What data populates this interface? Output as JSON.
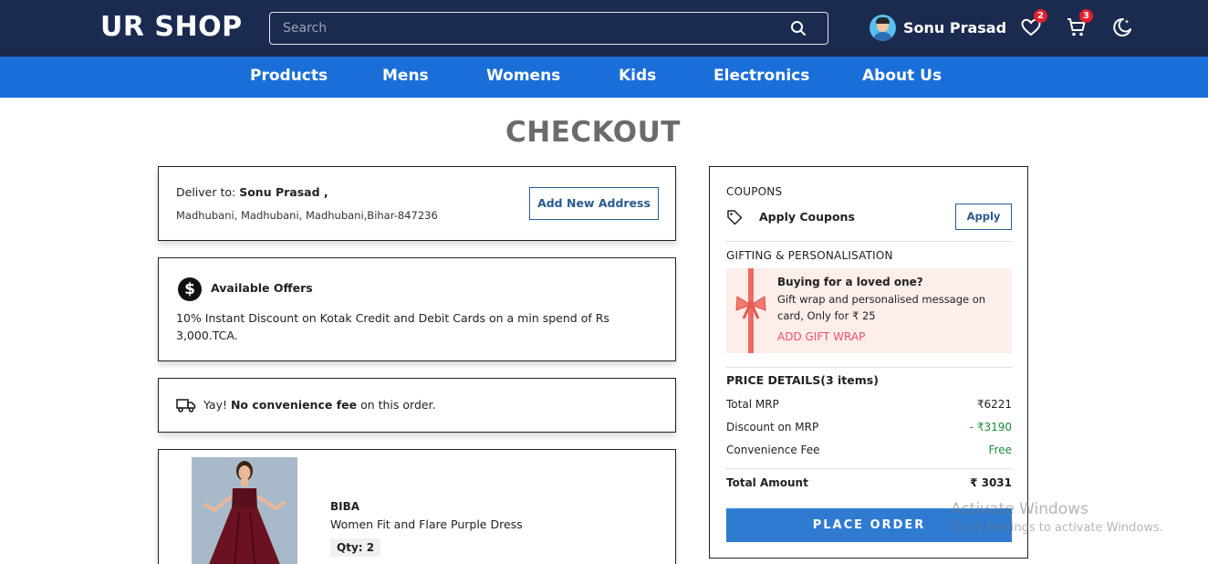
{
  "header": {
    "logo": "UR SHOP",
    "search_placeholder": "Search",
    "user_name": "Sonu Prasad",
    "wishlist_count": "2",
    "cart_count": "3"
  },
  "nav": {
    "items": [
      "Products",
      "Mens",
      "Womens",
      "Kids",
      "Electronics",
      "About Us"
    ]
  },
  "page_title": "CHECKOUT",
  "delivery": {
    "prefix": "Deliver to: ",
    "name": "Sonu Prasad ,",
    "address": "Madhubani, Madhubani, Madhubani,Bihar-847236",
    "add_address_label": "Add New Address"
  },
  "offers": {
    "heading": "Available Offers",
    "text": "10% Instant Discount on Kotak Credit and Debit Cards on a min spend of Rs 3,000.TCA."
  },
  "convenience": {
    "yay": "Yay! ",
    "bold": "No convenience fee",
    "rest": " on this order."
  },
  "product": {
    "brand": "BIBA",
    "name": "Women Fit and Flare Purple Dress",
    "qty": "Qty: 2"
  },
  "summary": {
    "coupons_label": "COUPONS",
    "apply_coupons": "Apply Coupons",
    "apply_button": "Apply",
    "gifting_label": "GIFTING & PERSONALISATION",
    "gift_title": "Buying for a loved one?",
    "gift_text": "Gift wrap and personalised message on card, Only for ₹ 25",
    "gift_action": "ADD GIFT WRAP",
    "price_heading": "PRICE DETAILS(3 items)",
    "rows": [
      {
        "label": "Total MRP",
        "value": "₹6221"
      },
      {
        "label": "Discount on MRP",
        "value": "- ₹3190"
      },
      {
        "label": "Convenience Fee",
        "value": "Free"
      }
    ],
    "total_label": "Total Amount",
    "total_value": "₹ 3031",
    "place_order": "PLACE ORDER"
  },
  "watermark": {
    "line1": "Activate Windows",
    "line2": "Go to Settings to activate Windows."
  },
  "colors": {
    "header_bg": "#1b2a4f",
    "nav_bg": "#1a6ed8",
    "place_order_bg": "#2f7bd1",
    "badge": "#e4202e",
    "discount_green": "#1e8a3a",
    "gift_action": "#ef4f6b"
  }
}
